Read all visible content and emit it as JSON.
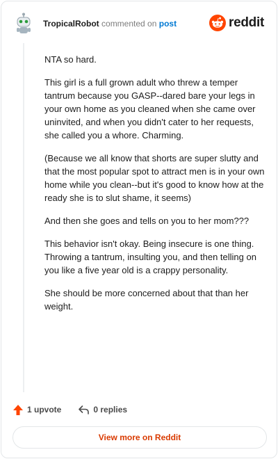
{
  "header": {
    "username": "TropicalRobot",
    "action_text": "commented on",
    "post_link": "post",
    "brand": "reddit"
  },
  "comment": {
    "paragraphs": [
      "NTA so hard.",
      "This girl is a full grown adult who threw a temper tantrum because you GASP--dared bare your legs in your own home as you cleaned when she came over uninvited, and when you didn't cater to her requests, she called you a whore. Charming.",
      "(Because we all know that shorts are super slutty and that the most popular spot to attract men is in your own home while you clean--but it's good to know how at the ready she is to slut shame, it seems)",
      "And then she goes and tells on you to her mom???",
      "This behavior isn't okay. Being insecure is one thing. Throwing a tantrum, insulting you, and then telling on you like a five year old is a crappy personality.",
      "She should be more concerned about that than her weight."
    ]
  },
  "actions": {
    "upvote_label": "1 upvote",
    "replies_label": "0 replies"
  },
  "footer": {
    "view_more_label": "View more on Reddit"
  },
  "colors": {
    "accent": "#d93a00",
    "upvote": "#ff4500",
    "link": "#0079d3"
  },
  "icons": [
    "avatar-robot",
    "reddit-logo-icon",
    "upvote-arrow-icon",
    "reply-arrow-icon"
  ]
}
